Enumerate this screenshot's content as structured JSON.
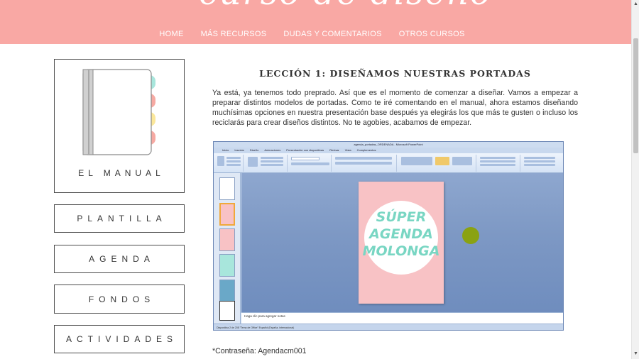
{
  "header": {
    "logo_text": "curso de diseño",
    "nav": [
      "HOME",
      "MÁS RECURSOS",
      "DUDAS Y COMENTARIOS",
      "OTROS CURSOS"
    ]
  },
  "sidebar": {
    "items": [
      "EL MANUAL",
      "PLANTILLA",
      "AGENDA",
      "FONDOS",
      "ACTIVIDADES"
    ]
  },
  "main": {
    "title": "LECCIÓN 1: DISEÑAMOS NUESTRAS PORTADAS",
    "body": "Ya está, ya tenemos todo preprado. Así que es el momento de comenzar a diseñar. Vamos a empezar a preparar distintos modelos de portadas. Como te iré comentando en el manual, ahora estamos diseñando muchísimas opciones en nuestra presentación base después ya elegirás los que más te gusten o incluso los reciclarás para crear diseños distintos. No te agobies, acabamos de empezar.",
    "password": "*Contraseña: Agendacm001"
  },
  "screenshot": {
    "window_title": "agenda_portadas_ORDENADA - Microsoft PowerPoint",
    "tabs": [
      "Inicio",
      "Insertar",
      "Diseño",
      "Animaciones",
      "Presentación con diapositivas",
      "Revisar",
      "Vista",
      "Complementos"
    ],
    "slide_text": "SÚPER AGENDA MOLONGA",
    "notes_placeholder": "Haga clic para agregar notas",
    "status_text": "Diapositiva 2 de 208    \"Tema de Office\"    Español (España, internacional)"
  },
  "colors": {
    "header_bg": "#f9a8a4",
    "slide_bg": "#f8c2c5",
    "slide_text": "#79d6c3",
    "notebook_tabs": [
      "#a8e6dc",
      "#f6a9a2",
      "#fbe79a",
      "#f6a9a2"
    ]
  }
}
